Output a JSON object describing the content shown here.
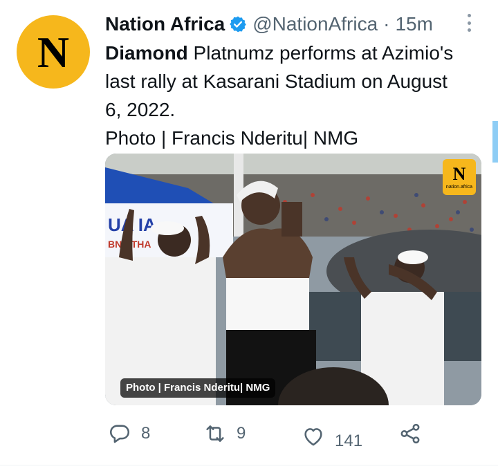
{
  "tweet": {
    "author_name": "Nation Africa",
    "avatar_letter": "N",
    "handle": "@NationAfrica",
    "separator": "·",
    "time": "15m",
    "text_bold": "Diamond",
    "text_line1": " Platnumz performs at Azimio's",
    "text_line2": "last rally at Kasarani Stadium on August",
    "text_line3": "6, 2022.",
    "text_line4": "Photo | Francis Nderitu| NMG"
  },
  "media": {
    "logo_letter": "N",
    "logo_text": "nation.africa",
    "photo_caption": "Photo | Francis Nderitu| NMG",
    "banner_text_1": "UA  IA",
    "banner_text_2": "BNA   THA"
  },
  "actions": {
    "reply_count": "8",
    "retweet_count": "9",
    "like_count": "141"
  },
  "colors": {
    "brand_yellow": "#f6b71c",
    "verified_blue": "#1d9bf0",
    "muted_text": "#536471"
  },
  "icons": [
    "verified-icon",
    "more-icon",
    "reply-icon",
    "retweet-icon",
    "like-icon",
    "share-icon"
  ]
}
